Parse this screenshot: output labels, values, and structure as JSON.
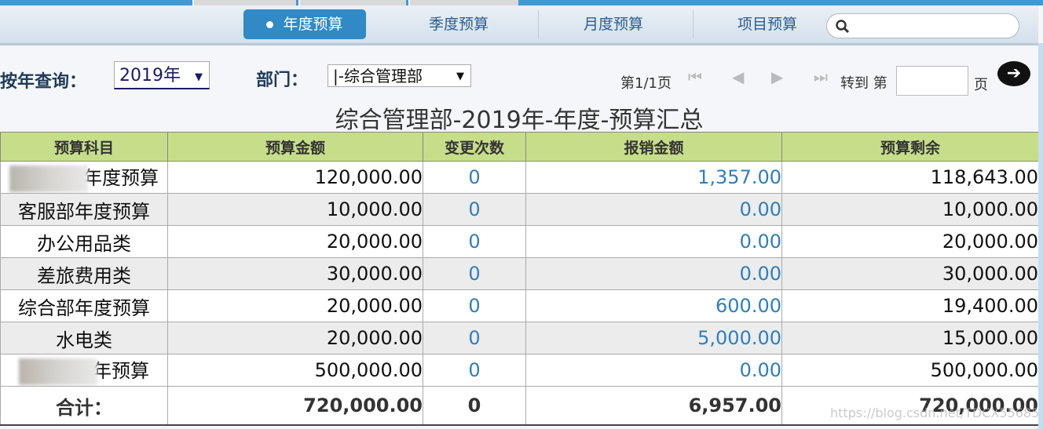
{
  "nav": {
    "tabs": [
      {
        "label": "年度预算",
        "active": true
      },
      {
        "label": "季度预算"
      },
      {
        "label": "月度预算"
      },
      {
        "label": "项目预算"
      }
    ],
    "search_placeholder": ""
  },
  "filters": {
    "year_label": "按年查询：",
    "year_value": "2019年",
    "dept_label": "部门：",
    "dept_value": "|-综合管理部"
  },
  "pager": {
    "page_info": "第1/1页",
    "goto_prefix": "转到 第",
    "goto_suffix": "页",
    "goto_value": ""
  },
  "report_title": "综合管理部-2019年-年度-预算汇总",
  "table": {
    "headers": [
      "预算科目",
      "预算金额",
      "变更次数",
      "报销金额",
      "预算剩余"
    ],
    "rows": [
      {
        "name": "年度预算",
        "blurred": true,
        "amount": "120,000.00",
        "changes": "0",
        "expense": "1,357.00",
        "remaining": "118,643.00"
      },
      {
        "name": "客服部年度预算",
        "amount": "10,000.00",
        "changes": "0",
        "expense": "0.00",
        "remaining": "10,000.00"
      },
      {
        "name": "办公用品类",
        "amount": "20,000.00",
        "changes": "0",
        "expense": "0.00",
        "remaining": "20,000.00"
      },
      {
        "name": "差旅费用类",
        "amount": "30,000.00",
        "changes": "0",
        "expense": "0.00",
        "remaining": "30,000.00"
      },
      {
        "name": "综合部年度预算",
        "amount": "20,000.00",
        "changes": "0",
        "expense": "600.00",
        "remaining": "19,400.00"
      },
      {
        "name": "水电类",
        "amount": "20,000.00",
        "changes": "0",
        "expense": "5,000.00",
        "remaining": "15,000.00"
      },
      {
        "name": "年预算",
        "blurred": true,
        "amount": "500,000.00",
        "changes": "0",
        "expense": "0.00",
        "remaining": "500,000.00"
      }
    ],
    "total": {
      "label": "合计：",
      "amount": "720,000.00",
      "changes": "0",
      "expense": "6,957.00",
      "remaining": "720,000.00"
    }
  },
  "watermark": "https://blog.csdn.net/TDCX55685878",
  "colors": {
    "accent": "#2f8ac6",
    "header_bg": "#c6de8a",
    "link": "#2e7fbf"
  }
}
